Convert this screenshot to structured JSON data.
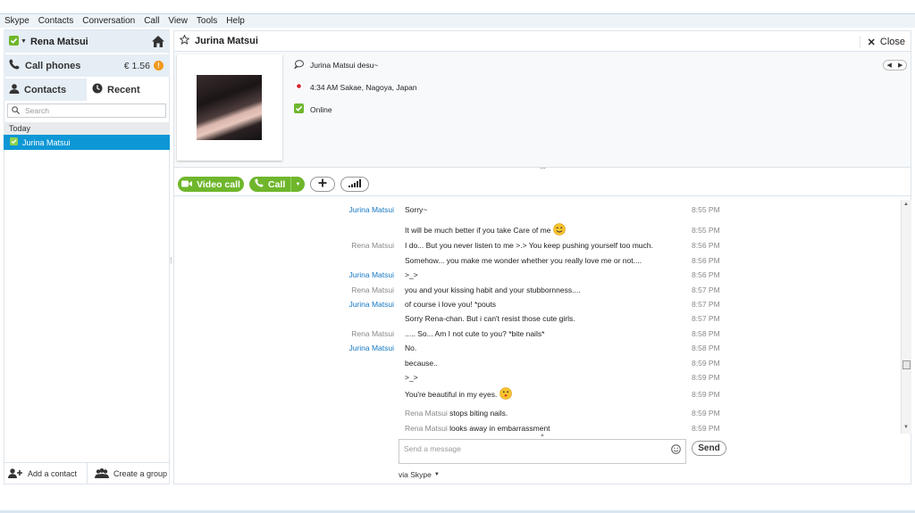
{
  "menubar": [
    "Skype",
    "Contacts",
    "Conversation",
    "Call",
    "View",
    "Tools",
    "Help"
  ],
  "profile": {
    "name": "Rena Matsui"
  },
  "call_phones": {
    "label": "Call phones",
    "credit": "€ 1.56",
    "badge": "!"
  },
  "tabs": {
    "contacts": "Contacts",
    "recent": "Recent"
  },
  "search": {
    "placeholder": "Search"
  },
  "contact_list": {
    "group": "Today",
    "items": [
      {
        "name": "Jurina Matsui"
      }
    ]
  },
  "sidebar_actions": {
    "add_contact": "Add a contact",
    "create_group": "Create a group"
  },
  "conversation": {
    "title": "Jurina Matsui",
    "close_label": "Close",
    "mood": "Jurina Matsui desu~",
    "location": "4:34 AM Sakae, Nagoya, Japan",
    "status": "Online"
  },
  "call_buttons": {
    "video": "Video call",
    "call": "Call"
  },
  "messages": [
    {
      "sender": "Jurina Matsui",
      "sender_color": "blue",
      "text": "Sorry~",
      "time": "8:55 PM"
    },
    {
      "sender": "",
      "sender_color": "",
      "text": "It will be much better if you take Care of me",
      "time": "8:55 PM",
      "emoji": "wink"
    },
    {
      "sender": "Rena Matsui",
      "sender_color": "gray",
      "text": "I do... But you never listen to me >.> You keep pushing yourself too much.",
      "time": "8:56 PM"
    },
    {
      "sender": "",
      "sender_color": "",
      "text": "Somehow... you make me wonder whether you really love me or not....",
      "time": "8:56 PM"
    },
    {
      "sender": "Jurina Matsui",
      "sender_color": "blue",
      "text": ">_>",
      "time": "8:56 PM"
    },
    {
      "sender": "Rena Matsui",
      "sender_color": "gray",
      "text": "you and your kissing habit and your stubbornness....",
      "time": "8:57 PM"
    },
    {
      "sender": "Jurina Matsui",
      "sender_color": "blue",
      "text": "of course i love you! *pouts",
      "time": "8:57 PM"
    },
    {
      "sender": "",
      "sender_color": "",
      "text": "Sorry Rena-chan. But i can't resist those cute girls.",
      "time": "8:57 PM"
    },
    {
      "sender": "Rena Matsui",
      "sender_color": "gray",
      "text": "..... So... Am I not cute to you? *bite nails*",
      "time": "8:58 PM"
    },
    {
      "sender": "Jurina Matsui",
      "sender_color": "blue",
      "text": "No.",
      "time": "8:58 PM"
    },
    {
      "sender": "",
      "sender_color": "",
      "text": "because..",
      "time": "8:59 PM"
    },
    {
      "sender": "",
      "sender_color": "",
      "text": ">_>",
      "time": "8:59 PM"
    },
    {
      "sender": "",
      "sender_color": "",
      "text": "You're beautiful in my eyes.",
      "time": "8:59 PM",
      "emoji": "kiss"
    },
    {
      "sender": "",
      "sender_color": "",
      "action_name": "Rena Matsui",
      "text": "stops biting nails.",
      "time": "8:59 PM"
    },
    {
      "sender": "",
      "sender_color": "",
      "action_name": "Rena Matsui",
      "text": "looks away in embarrassment",
      "time": "8:59 PM"
    }
  ],
  "compose": {
    "placeholder": "Send a message",
    "send_label": "Send",
    "via": "via Skype"
  },
  "colors": {
    "accent_blue": "#0e97d6",
    "call_green": "#6fb62c",
    "name_blue": "#1578c5"
  }
}
